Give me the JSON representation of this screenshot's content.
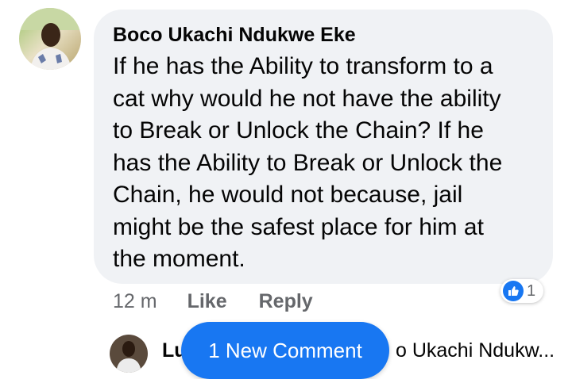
{
  "comment": {
    "author": "Boco Ukachi Ndukwe Eke",
    "lines": [
      "If he has the Ability to transform to a",
      "cat why would he not have the ability",
      "to Break or Unlock the Chain? If he",
      "has the Ability to Break or Unlock the",
      "Chain, he would not because, jail",
      "might be the safest place for him at",
      "the moment."
    ],
    "reaction": {
      "icon": "thumbs-up-icon",
      "count": "1",
      "color": "#1877f2"
    },
    "actions": {
      "time": "12 m",
      "like_label": "Like",
      "reply_label": "Reply"
    }
  },
  "reply_preview": {
    "author_visible": "Lu",
    "text_visible": "o Ukachi Ndukw..."
  },
  "new_comment_button": {
    "label": "1 New Comment",
    "color": "#1877f2"
  }
}
